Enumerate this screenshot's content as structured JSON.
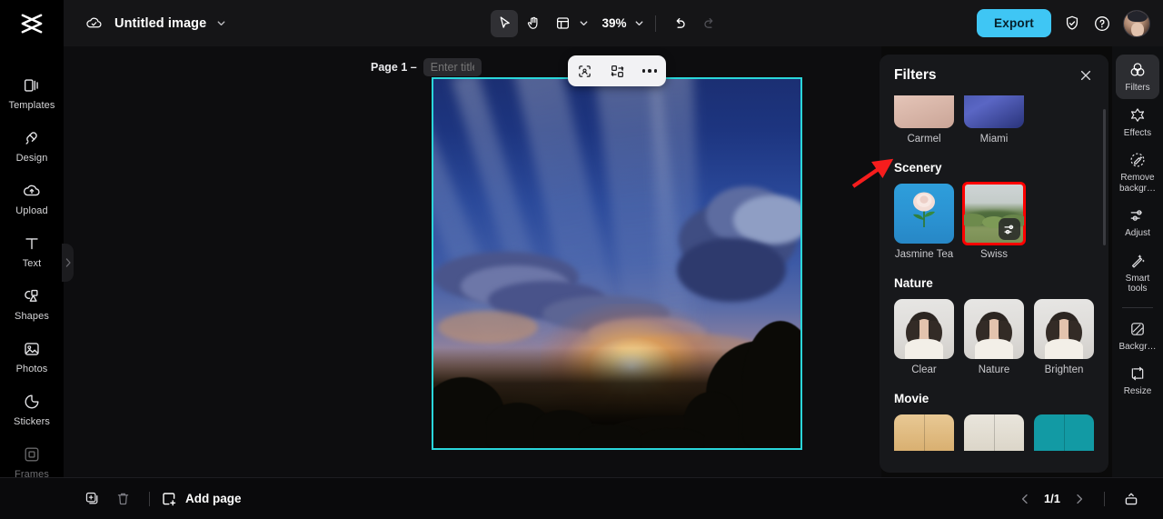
{
  "app": {
    "logo": "capcut-logo",
    "document_title": "Untitled image",
    "cloud_status_icon": "cloud-check-icon",
    "title_chevron_icon": "chevron-down-icon"
  },
  "toolbar": {
    "select_tool_icon": "cursor-arrow-icon",
    "hand_tool_icon": "hand-icon",
    "layout_tool_icon": "layout-panel-icon",
    "layout_chevron_icon": "chevron-down-icon",
    "zoom_level": "39%",
    "zoom_chevron_icon": "chevron-down-icon",
    "undo_icon": "undo-arrow-icon",
    "redo_icon": "redo-arrow-icon",
    "export_label": "Export",
    "shield_icon": "shield-check-icon",
    "help_icon": "question-circle-icon",
    "avatar_icon": "user-avatar"
  },
  "sidebar": {
    "items": [
      {
        "label": "Templates",
        "icon": "templates-icon",
        "dim": false
      },
      {
        "label": "Design",
        "icon": "design-icon",
        "dim": false
      },
      {
        "label": "Upload",
        "icon": "upload-cloud-icon",
        "dim": false
      },
      {
        "label": "Text",
        "icon": "text-t-icon",
        "dim": false
      },
      {
        "label": "Shapes",
        "icon": "shapes-icon",
        "dim": false
      },
      {
        "label": "Photos",
        "icon": "photo-icon",
        "dim": false
      },
      {
        "label": "Stickers",
        "icon": "sticker-icon",
        "dim": false
      },
      {
        "label": "Frames",
        "icon": "frame-icon",
        "dim": true
      }
    ],
    "more_chevron_icon": "chevron-down-icon",
    "expand_handle_icon": "chevron-right-icon"
  },
  "canvas": {
    "page_label": "Page 1 –",
    "page_title_placeholder": "Enter title",
    "page_title_value": "",
    "duplicate_icon": "duplicate-page-icon",
    "more_icon": "more-horizontal-icon",
    "float_toolbar": {
      "crop_icon": "crop-subject-icon",
      "swap_icon": "replace-image-icon",
      "more_icon": "more-horizontal-icon"
    },
    "image_alt": "sunset-sky-photo",
    "selection_color": "#2ad6da"
  },
  "filters_panel": {
    "title": "Filters",
    "close_icon": "close-x-icon",
    "sections": [
      {
        "name": "",
        "items": [
          {
            "label": "Carmel",
            "thumb": "t-carmel",
            "selected": false
          },
          {
            "label": "Miami",
            "thumb": "t-miami",
            "selected": false
          }
        ]
      },
      {
        "name": "Scenery",
        "items": [
          {
            "label": "Jasmine Tea",
            "thumb": "t-jasmine",
            "selected": false
          },
          {
            "label": "Swiss",
            "thumb": "t-swiss",
            "selected": true,
            "badge_icon": "adjust-sliders-icon"
          }
        ]
      },
      {
        "name": "Nature",
        "items": [
          {
            "label": "Clear",
            "thumb": "t-portrait",
            "selected": false
          },
          {
            "label": "Nature",
            "thumb": "t-portrait",
            "selected": false
          },
          {
            "label": "Brighten",
            "thumb": "t-portrait",
            "selected": false
          }
        ]
      },
      {
        "name": "Movie",
        "items": [
          {
            "label": "",
            "thumb": "t-mov1",
            "selected": false
          },
          {
            "label": "",
            "thumb": "t-mov2",
            "selected": false
          },
          {
            "label": "",
            "thumb": "t-mov3",
            "selected": false
          }
        ]
      }
    ]
  },
  "rail": {
    "items": [
      {
        "label": "Filters",
        "icon": "filters-circles-icon",
        "active": true
      },
      {
        "label": "Effects",
        "icon": "effects-star-icon",
        "active": false
      },
      {
        "label": "Remove backgr…",
        "icon": "remove-background-icon",
        "active": false
      },
      {
        "label": "Adjust",
        "icon": "adjust-sliders-icon",
        "active": false
      },
      {
        "label": "Smart tools",
        "icon": "smart-wand-icon",
        "active": false
      },
      {
        "label": "Backgr…",
        "icon": "background-icon",
        "active": false
      },
      {
        "label": "Resize",
        "icon": "resize-icon",
        "active": false
      }
    ]
  },
  "bottombar": {
    "duplicate_icon": "duplicate-page-icon",
    "delete_icon": "trash-icon",
    "add_page_icon": "add-page-icon",
    "add_page_label": "Add page",
    "prev_icon": "chevron-left-icon",
    "next_icon": "chevron-right-icon",
    "page_indicator": "1/1",
    "panel_toggle_icon": "expand-panel-icon"
  },
  "annotation": {
    "arrow_color": "#f61d1d",
    "points_to": "Scenery"
  }
}
